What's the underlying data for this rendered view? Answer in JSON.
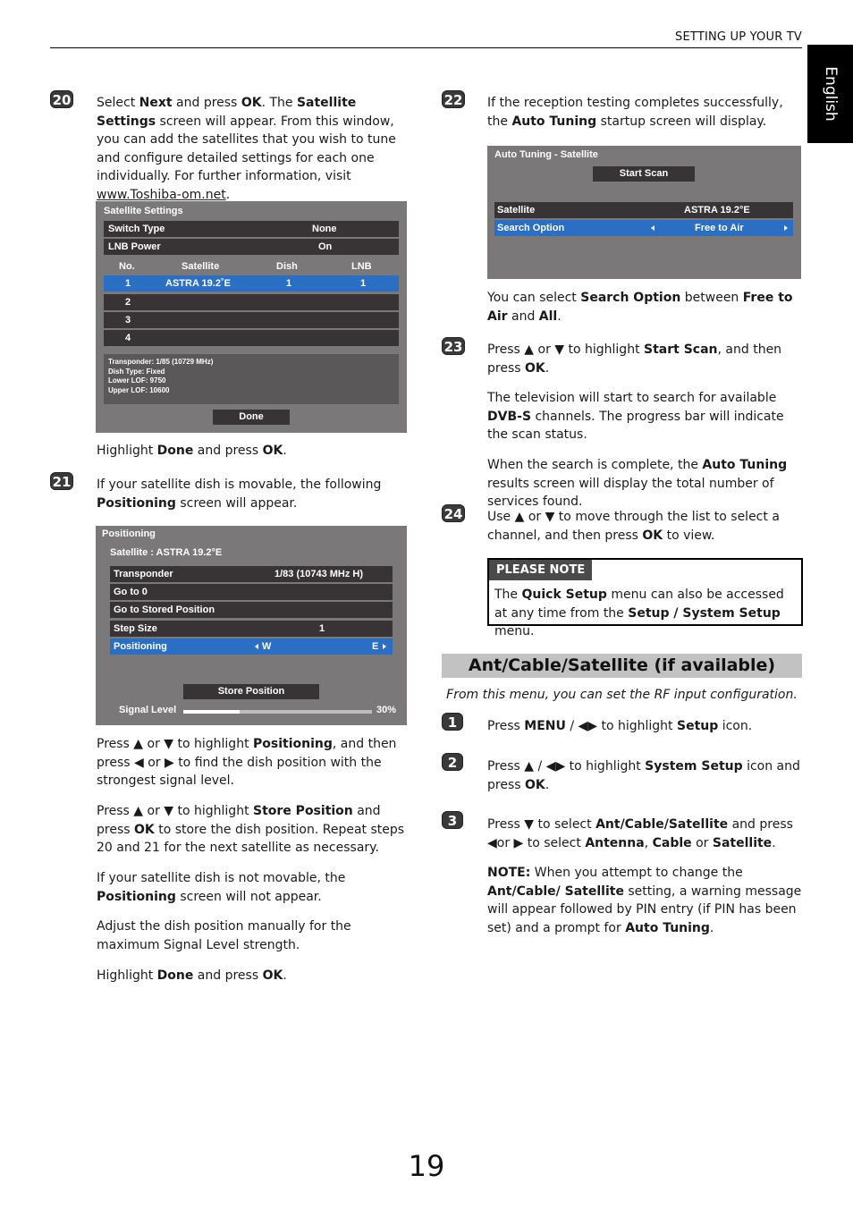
{
  "header": {
    "section_title": "SETTING UP YOUR TV",
    "language_tab": "English"
  },
  "page_number": "19",
  "steps": {
    "s20": {
      "badge": "20",
      "text_html": "Select <b>Next</b> and press <b>OK</b>. The <b>Satellite Settings</b> screen will appear. From this window, you can add the satellites that you wish to tune and configure detailed settings for each one individually. For further information, visit <u>www.Toshiba-om.net</u>.",
      "after": "Highlight <b>Done</b> and press <b>OK</b>."
    },
    "s21": {
      "badge": "21",
      "text_html": "If your satellite dish is movable, the following <b>Positioning</b> screen will appear.",
      "after": [
        "Press &#9650; or &#9660; to highlight <b>Positioning</b>, and then press &#9664; or &#9654; to find the dish position with the strongest signal level.",
        "Press &#9650; or &#9660; to highlight <b>Store Position</b> and press <b>OK</b> to store the dish position. Repeat steps 20 and 21 for the next satellite as necessary.",
        "If your satellite dish is not movable, the <b>Positioning</b> screen will not appear.",
        "Adjust the dish position manually for the maximum Signal Level strength.",
        "Highlight <b>Done</b> and press <b>OK</b>."
      ]
    },
    "s22": {
      "badge": "22",
      "text_html": "If the reception testing completes successfully, the <b>Auto Tuning</b> startup screen will display.",
      "after": "You can select <b>Search Option</b> between <b>Free to Air</b> and <b>All</b>."
    },
    "s23": {
      "badge": "23",
      "text_html": "Press &#9650; or &#9660; to highlight <b>Start Scan</b>, and then press <b>OK</b>.",
      "after": [
        "The television will start to search for available <b>DVB-S</b> channels. The progress bar will indicate the scan status.",
        "When the search is complete, the <b>Auto Tuning</b> results screen will display the total number of services found."
      ]
    },
    "s24": {
      "badge": "24",
      "text_html": "Use &#9650; or &#9660; to move through the list to select a channel, and then press <b>OK</b> to view."
    }
  },
  "satellite_settings": {
    "title": "Satellite Settings",
    "switch_type": {
      "label": "Switch Type",
      "value": "None"
    },
    "lnb_power": {
      "label": "LNB Power",
      "value": "On"
    },
    "columns": [
      "No.",
      "Satellite",
      "Dish",
      "LNB"
    ],
    "rows": [
      {
        "no": "1",
        "satellite": "ASTRA 19.2˚E",
        "dish": "1",
        "lnb": "1",
        "selected": true
      },
      {
        "no": "2",
        "satellite": "",
        "dish": "",
        "lnb": ""
      },
      {
        "no": "3",
        "satellite": "",
        "dish": "",
        "lnb": ""
      },
      {
        "no": "4",
        "satellite": "",
        "dish": "",
        "lnb": ""
      }
    ],
    "info": [
      "Transponder: 1/85 (10729 MHz)",
      "Dish Type: Fixed",
      "Lower LOF: 9750",
      "Upper LOF: 10600"
    ],
    "done_label": "Done"
  },
  "positioning": {
    "title": "Positioning",
    "satellite": "Satellite : ASTRA 19.2°E",
    "rows": [
      {
        "label": "Transponder",
        "value": "1/83 (10743 MHz  H)"
      },
      {
        "label": "Go to 0",
        "value": ""
      },
      {
        "label": "Go to Stored Position",
        "value": ""
      },
      {
        "label": "Step Size",
        "value": "1"
      }
    ],
    "positioning_row": {
      "label": "Positioning",
      "left": "W",
      "right": "E"
    },
    "store_label": "Store Position",
    "signal_label": "Signal Level",
    "signal_percent": 30,
    "signal_text": "30%"
  },
  "auto_tuning": {
    "title": "Auto Tuning - Satellite",
    "start_scan": "Start Scan",
    "satellite": {
      "label": "Satellite",
      "value": "ASTRA 19.2°E"
    },
    "search_option": {
      "label": "Search Option",
      "value": "Free to Air"
    }
  },
  "note": {
    "header": "PLEASE NOTE",
    "text_html": "The <b>Quick Setup</b> menu can also be accessed at any time from the <b>Setup / System Setup</b> menu."
  },
  "section": {
    "title": "Ant/Cable/Satellite (if available)",
    "intro": "From this menu, you can set the RF input configuration.",
    "steps": [
      {
        "badge": "1",
        "text_html": "Press <b>MENU</b> / &#9664;&#9654; to highlight <b>Setup</b> icon."
      },
      {
        "badge": "2",
        "text_html": "Press &#9650; / &#9664;&#9654; to highlight <b>System Setup</b> icon and press <b>OK</b>."
      },
      {
        "badge": "3",
        "text_html": "Press &#9660; to select <b>Ant/Cable/Satellite</b> and press &#9664;or &#9654; to select <b>Antenna</b>, <b>Cable</b> or <b>Satellite</b>."
      }
    ],
    "note_html": "<b>NOTE:</b> When you attempt to change the <b>Ant/Cable/ Satellite</b> setting, a warning message will appear followed by PIN entry (if PIN has been set) and a prompt for <b>Auto Tuning</b>."
  },
  "colors": {
    "tv_bg": "#7a7878",
    "tv_row": "#383435",
    "tv_selected": "#2a6fc4",
    "section_bar": "#c2c2c2"
  }
}
